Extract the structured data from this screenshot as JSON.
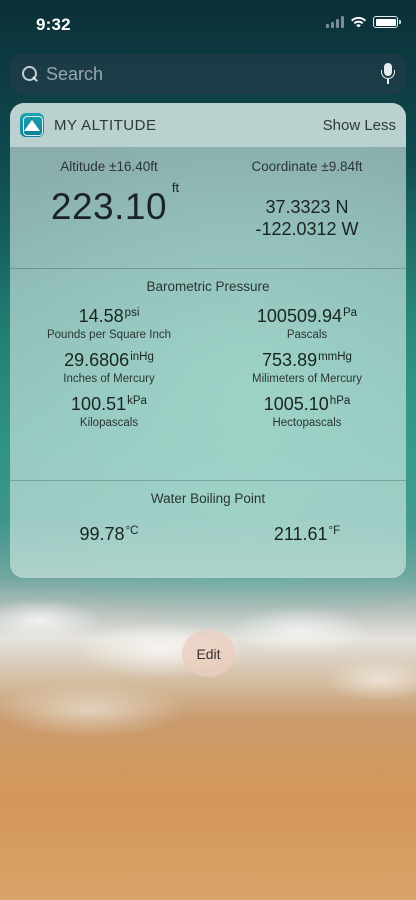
{
  "status_bar": {
    "time": "9:32"
  },
  "search": {
    "placeholder": "Search"
  },
  "widget": {
    "title": "MY ALTITUDE",
    "toggle_label": "Show Less",
    "altitude": {
      "label": "Altitude ±16.40ft",
      "value": "223.10",
      "unit": "ft"
    },
    "coordinate": {
      "label": "Coordinate ±9.84ft",
      "latitude": "37.3323 N",
      "longitude": "-122.0312 W"
    },
    "pressure": {
      "title": "Barometric Pressure",
      "items": [
        {
          "value": "14.58",
          "unit": "psi",
          "label": "Pounds per Square Inch"
        },
        {
          "value": "100509.94",
          "unit": "Pa",
          "label": "Pascals"
        },
        {
          "value": "29.6806",
          "unit": "inHg",
          "label": "Inches of Mercury"
        },
        {
          "value": "753.89",
          "unit": "mmHg",
          "label": "Milimeters of Mercury"
        },
        {
          "value": "100.51",
          "unit": "kPa",
          "label": "Kilopascals"
        },
        {
          "value": "1005.10",
          "unit": "hPa",
          "label": "Hectopascals"
        }
      ]
    },
    "boiling": {
      "title": "Water Boiling Point",
      "celsius": {
        "value": "99.78",
        "unit": "°C"
      },
      "fahrenheit": {
        "value": "211.61",
        "unit": "°F"
      }
    }
  },
  "edit_label": "Edit",
  "colors": {
    "app_icon": "#1aa3b3"
  }
}
